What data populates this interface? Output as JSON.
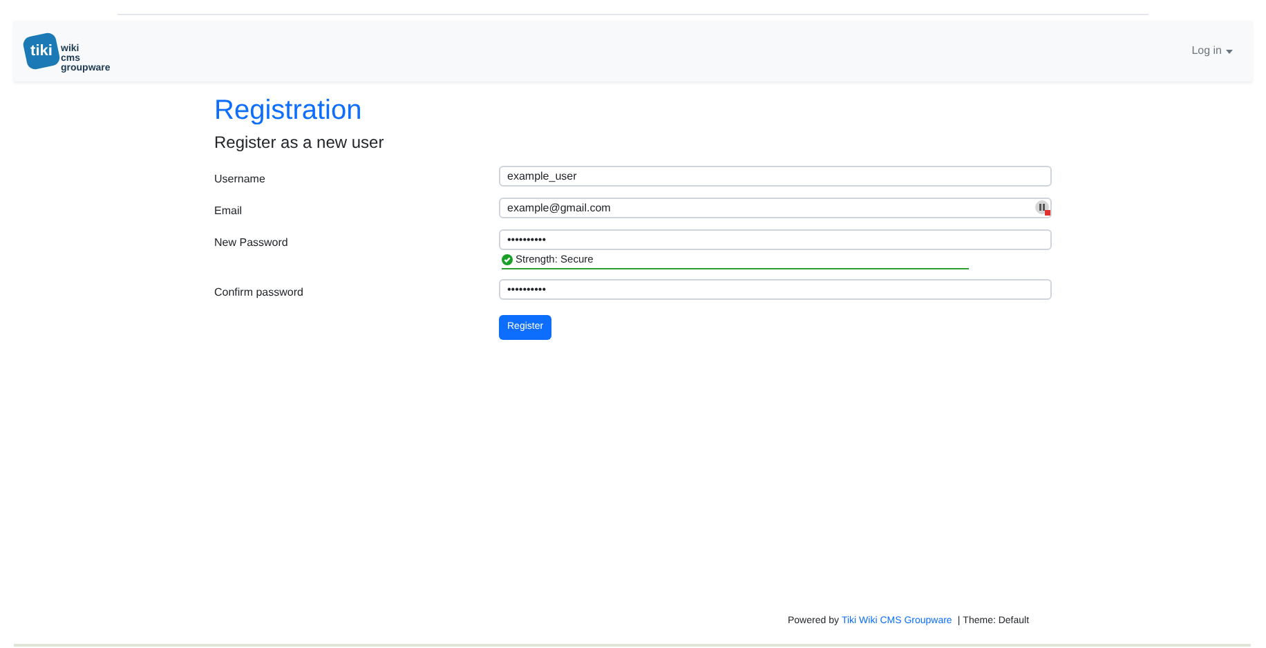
{
  "header": {
    "logo": {
      "mark": "tiki",
      "text": [
        "wiki",
        "cms",
        "groupware"
      ]
    },
    "login_menu": "Log in"
  },
  "title": "Registration",
  "subtitle": "Register as a new user",
  "fields": [
    {
      "label": "Username",
      "value": "example_user"
    },
    {
      "label": "Email",
      "value": "example@gmail.com",
      "addon_icon": true
    },
    {
      "label": "New Password",
      "value": "••••••••••",
      "strength": {
        "text": "Strength: Secure"
      }
    },
    {
      "label": "Confirm password",
      "value": "••••••••••"
    }
  ],
  "submit": "Register",
  "footer": {
    "prefix": "Powered by",
    "link": "Tiki Wiki CMS Groupware",
    "separator": "|",
    "theme": "Theme: Default"
  }
}
